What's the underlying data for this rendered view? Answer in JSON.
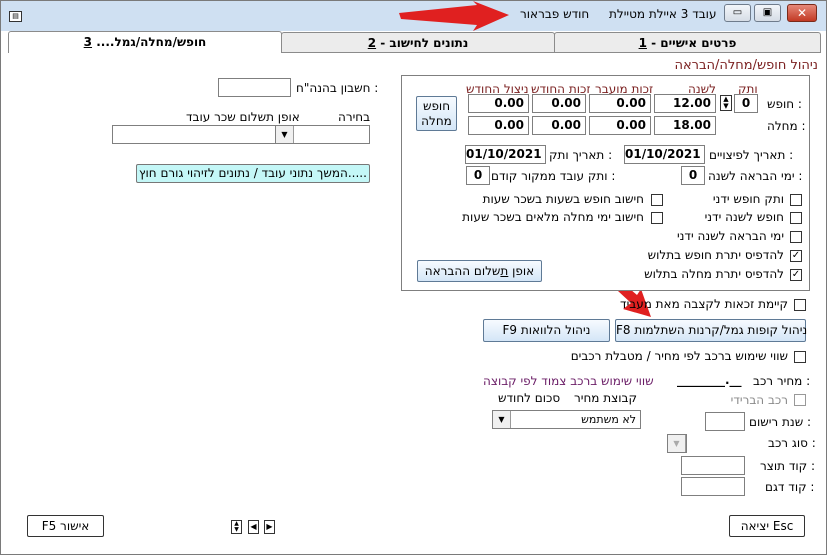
{
  "titlebar": {
    "title": "עובד 3 איילת מטיילת",
    "month": "חודש פבראור"
  },
  "tabs": [
    {
      "label": "פרטים אישיים - ",
      "num": "1"
    },
    {
      "label": "נתונים לחישוב - ",
      "num": "2"
    },
    {
      "label": "חופש/מחלה/גמל.... ",
      "num": "3"
    }
  ],
  "section_title": "ניהול חופש/מחלה/הבראה",
  "leave_table": {
    "headers": [
      "ותק",
      "לשנה",
      "זכות מועבר",
      "זכות החודש",
      "ניצול החודש"
    ],
    "rows": [
      {
        "label": "חופש :",
        "seniority": "0",
        "per_year": "12.00",
        "carried": "0.00",
        "this_month": "0.00",
        "used": "0.00"
      },
      {
        "label": "מחלה :",
        "per_year": "18.00",
        "carried": "0.00",
        "this_month": "0.00",
        "used": "0.00"
      }
    ],
    "vacation_sick_button": "חופש\nמחלה"
  },
  "dates": {
    "severance_label": "תאריך לפיצויים :",
    "severance_value": "01/10/2021",
    "seniority_date_label": "תאריך ותק :",
    "seniority_date_value": "01/10/2021",
    "recreation_days_label": "ימי הבראה לשנה :",
    "recreation_days_value": "0",
    "prev_seniority_label": "ותק עובד ממקור קודם :",
    "prev_seniority_value": "0"
  },
  "checkboxes": [
    {
      "label": "ותק חופש ידני",
      "checked": false
    },
    {
      "label": "חישוב חופש בשעות בשכר שעות",
      "checked": false
    },
    {
      "label": "חופש לשנה ידני",
      "checked": false
    },
    {
      "label": "חישוב ימי מחלה מלאים בשכר שעות",
      "checked": false
    },
    {
      "label": "ימי הבראה לשנה ידני",
      "checked": false
    },
    {
      "label": "להדפיס יתרת חופש בתלוש",
      "checked": true
    },
    {
      "label": "להדפיס יתרת מחלה בתלוש",
      "checked": true
    }
  ],
  "recreation_pay_button": {
    "prefix": "אופן ",
    "underlined": "ת",
    "rest": "שלום ההבראה"
  },
  "left": {
    "bank_account_label": "חשבון בהנה\"ח :",
    "bank_account_value": "",
    "choice_label": "בחירה",
    "wage_method_label": "אופן תשלום שכר עובד",
    "external_button": "המשך נתוני עובד / נתונים לזיהוי גורם חוץ....."
  },
  "transfer_check": {
    "label": "קיימת זכאות לקצבה מאת מעביד",
    "checked": false
  },
  "f8_button": "F8 ניהול קופות גמל/קרנות השתלמות",
  "f9_button": "F9 ניהול הלוואות",
  "car": {
    "usage_check_label": "שווי שימוש ברכב לפי מחיר / מטבלת רכבים",
    "usage_checked": false,
    "price_label": "מחיר רכב :",
    "price_value": "________.__",
    "hybrid_label": "רכב הברידי",
    "reg_year_label": "שנת רישום :",
    "type_label": "סוג רכב :",
    "maker_label": "קוד תוצר :",
    "model_label": "קוד דגם :",
    "group_title": "שווי שימוש ברכב צמוד לפי קבוצה",
    "price_group_label": "קבוצת מחיר",
    "monthly_label": "סכום לחודש",
    "group_value": "לא משתמש"
  },
  "footer": {
    "exit_button": "יציאה Esc",
    "ok_button": "F5 אישור"
  }
}
